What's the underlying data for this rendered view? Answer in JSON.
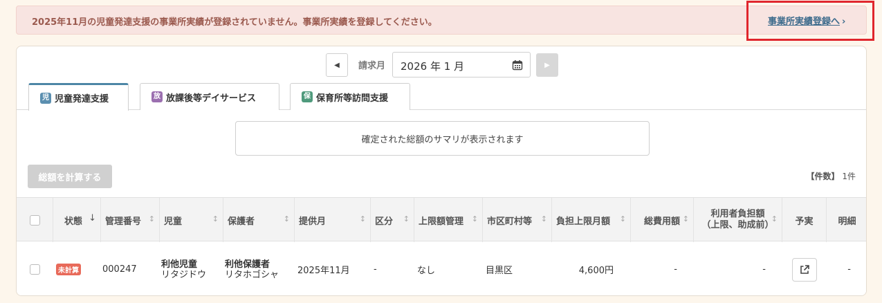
{
  "alert": {
    "message": "2025年11月の児童発達支援の事業所実績が登録されていません。事業所実績を登録してください。",
    "link_label": "事業所実績登録へ",
    "link_chevron": "›"
  },
  "month_picker": {
    "label": "請求月",
    "value": "2026 年 1 月",
    "prev_icon": "◀",
    "next_icon": "▶"
  },
  "tabs": [
    {
      "badge": "児",
      "badge_color": "#5b8fb0",
      "label": "児童発達支援",
      "active": true
    },
    {
      "badge": "放",
      "badge_color": "#9b6fb0",
      "label": "放課後等デイサービス",
      "active": false
    },
    {
      "badge": "保",
      "badge_color": "#4f9a7c",
      "label": "保育所等訪問支援",
      "active": false
    }
  ],
  "summary": {
    "text": "確定された総額のサマリが表示されます"
  },
  "calc_button": {
    "label": "総額を計算する"
  },
  "count": {
    "label": "【件数】",
    "value": "1件"
  },
  "table": {
    "headers": {
      "status": "状態",
      "status_sort": "↓",
      "mgmt_no": "管理番号",
      "child": "児童",
      "guardian": "保護者",
      "month": "提供月",
      "category": "区分",
      "limit_mgmt": "上限額管理",
      "city": "市区町村等",
      "limit_month": "負担上限月額",
      "total": "総費用額",
      "user_burden_1": "利用者負担額",
      "user_burden_2": "（上限、助成前）",
      "plan": "予実",
      "detail": "明細"
    },
    "rows": [
      {
        "status": "未計算",
        "mgmt_no": "000247",
        "child_name": "利他児童",
        "child_kana": "リタジドウ",
        "guardian_name": "利他保護者",
        "guardian_kana": "リタホゴシャ",
        "month": "2025年11月",
        "category": "-",
        "limit_mgmt": "なし",
        "city": "目黒区",
        "limit_month": "4,600円",
        "total": "-",
        "user_burden": "-",
        "detail": "-"
      }
    ]
  }
}
